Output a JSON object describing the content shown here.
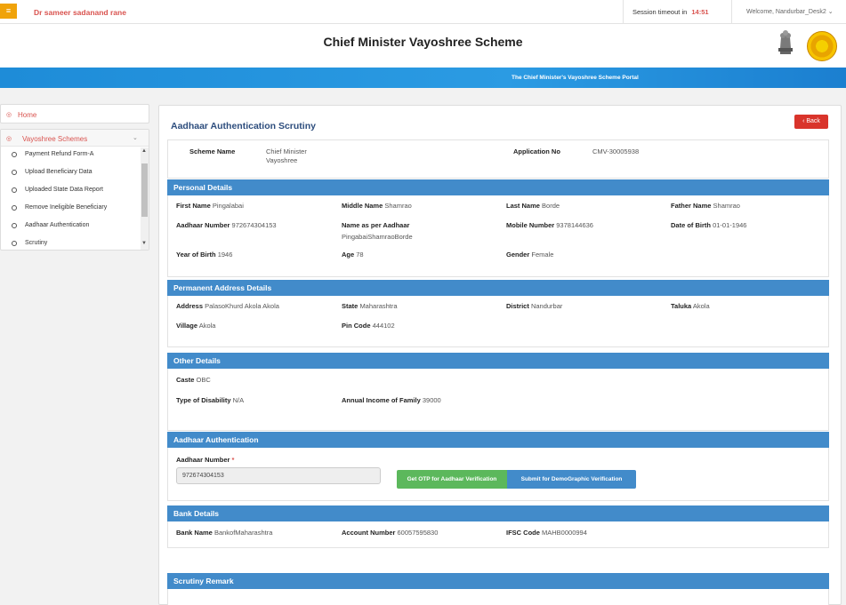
{
  "topbar": {
    "user_name": "Dr sameer sadanand rane",
    "session_label": "Session timeout in",
    "session_time": "14:51",
    "welcome": "Welcome, Nandurbar_Desk2"
  },
  "header": {
    "title": "Chief Minister Vayoshree Scheme",
    "portal_banner": "The Chief Minister's Vayoshree Scheme Portal"
  },
  "sidebar": {
    "home": "Home",
    "section": "Vayoshree Schemes",
    "items": [
      {
        "label": "Payment Refund Form-A"
      },
      {
        "label": "Upload Beneficiary Data"
      },
      {
        "label": "Uploaded State Data Report"
      },
      {
        "label": "Remove Ineligible Beneficiary"
      },
      {
        "label": "Aadhaar Authentication"
      },
      {
        "label": "Scrutiny"
      }
    ]
  },
  "page": {
    "title": "Aadhaar Authentication Scrutiny",
    "back_label": "‹ Back"
  },
  "scheme": {
    "scheme_name_label": "Scheme Name",
    "scheme_name_line1": "Chief Minister",
    "scheme_name_line2": "Vayoshree",
    "application_no_label": "Application No",
    "application_no": "CMV-30005938"
  },
  "personal": {
    "heading": "Personal Details",
    "first_name_label": "First Name",
    "first_name": "Pingalabai",
    "middle_name_label": "Middle Name",
    "middle_name": "Shamrao",
    "last_name_label": "Last Name",
    "last_name": "Borde",
    "father_name_label": "Father Name",
    "father_name": "Shamrao",
    "aadhaar_label": "Aadhaar Number",
    "aadhaar": "972674304153",
    "name_aadhaar_label": "Name as per Aadhaar",
    "name_aadhaar": "PingabaiShamraoBorde",
    "mobile_label": "Mobile Number",
    "mobile": "9378144636",
    "dob_label": "Date of Birth",
    "dob": "01-01-1946",
    "yob_label": "Year of Birth",
    "yob": "1946",
    "age_label": "Age",
    "age": "78",
    "gender_label": "Gender",
    "gender": "Female"
  },
  "address": {
    "heading": "Permanent Address Details",
    "address_label": "Address",
    "address": "PalasoKhurd Akola Akola",
    "state_label": "State",
    "state": "Maharashtra",
    "district_label": "District",
    "district": "Nandurbar",
    "taluka_label": "Taluka",
    "taluka": "Akola",
    "village_label": "Village",
    "village": "Akola",
    "pin_label": "Pin Code",
    "pin": "444102"
  },
  "other": {
    "heading": "Other Details",
    "caste_label": "Caste",
    "caste": "OBC",
    "disability_label": "Type of Disability",
    "disability": "N/A",
    "income_label": "Annual Income of Family",
    "income": "39000"
  },
  "aadhaar_auth": {
    "heading": "Aadhaar Authentication",
    "field_label": "Aadhaar Number",
    "required_mark": "*",
    "value": "972674304153",
    "otp_button": "Get OTP for Aadhaar Verification",
    "demo_button": "Submit for DemoGraphic Verification"
  },
  "bank": {
    "heading": "Bank Details",
    "bank_name_label": "Bank Name",
    "bank_name": "BankofMaharashtra",
    "account_label": "Account Number",
    "account": "60057595830",
    "ifsc_label": "IFSC Code",
    "ifsc": "MAHB0000994"
  },
  "remark": {
    "heading": "Scrutiny Remark"
  },
  "colors": {
    "accent_blue": "#428bca",
    "danger": "#d9534f",
    "success": "#5cb85c",
    "brand_orange": "#f0a30a"
  }
}
